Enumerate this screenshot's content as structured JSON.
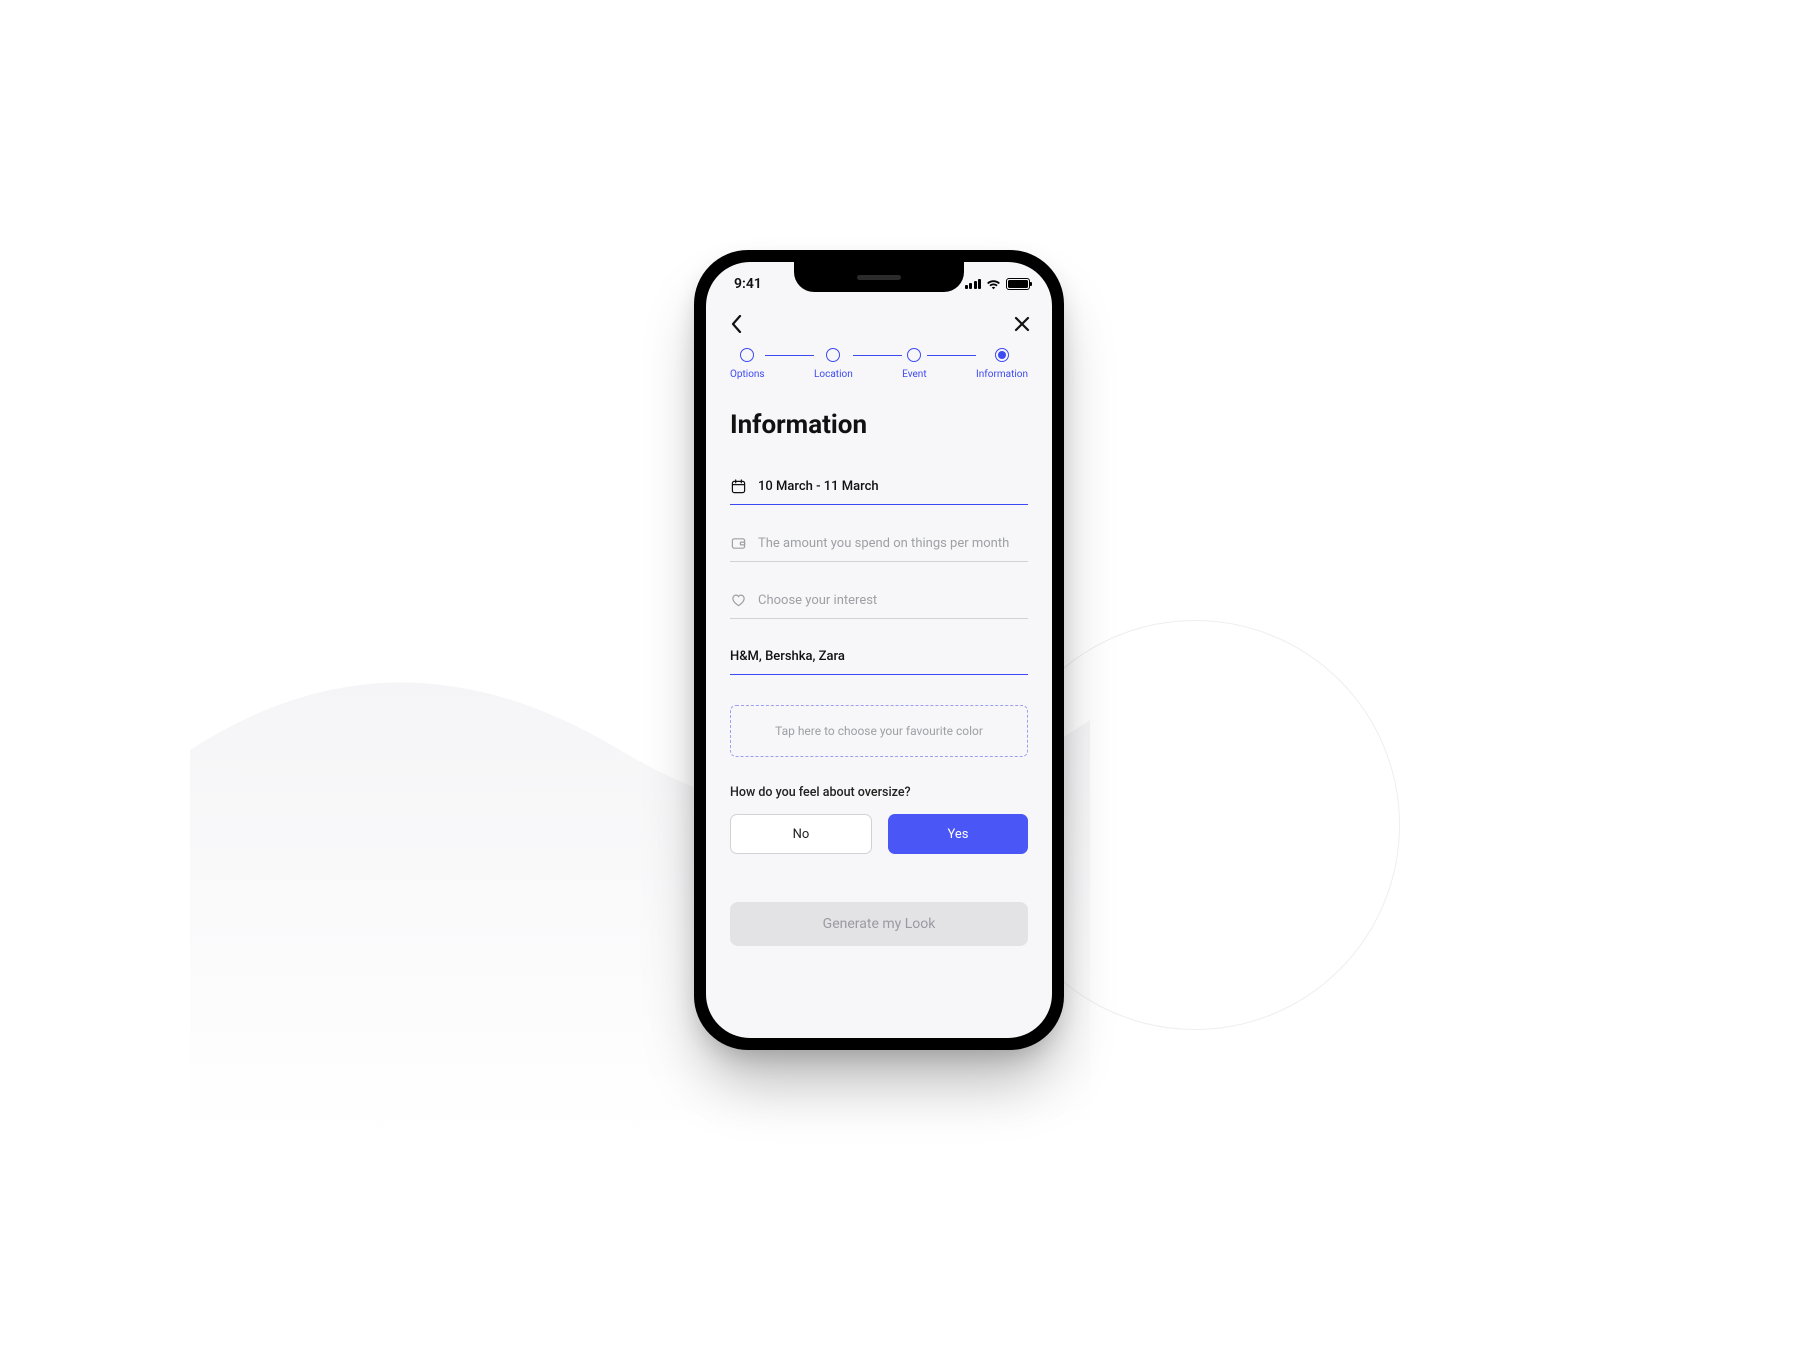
{
  "status_bar": {
    "time": "9:41"
  },
  "stepper": {
    "steps": [
      {
        "label": "Options"
      },
      {
        "label": "Location"
      },
      {
        "label": "Event"
      },
      {
        "label": "Information"
      }
    ]
  },
  "page_title": "Information",
  "fields": {
    "date": {
      "value": "10 March - 11 March"
    },
    "budget": {
      "placeholder": "The amount you spend on things per month"
    },
    "interest": {
      "placeholder": "Choose your interest"
    },
    "brands": {
      "value": "H&M, Bershka, Zara"
    }
  },
  "color_picker": {
    "placeholder": "Tap here to choose your favourite color"
  },
  "oversize": {
    "question": "How do you feel about oversize?",
    "no_label": "No",
    "yes_label": "Yes"
  },
  "cta": {
    "label": "Generate my Look"
  }
}
